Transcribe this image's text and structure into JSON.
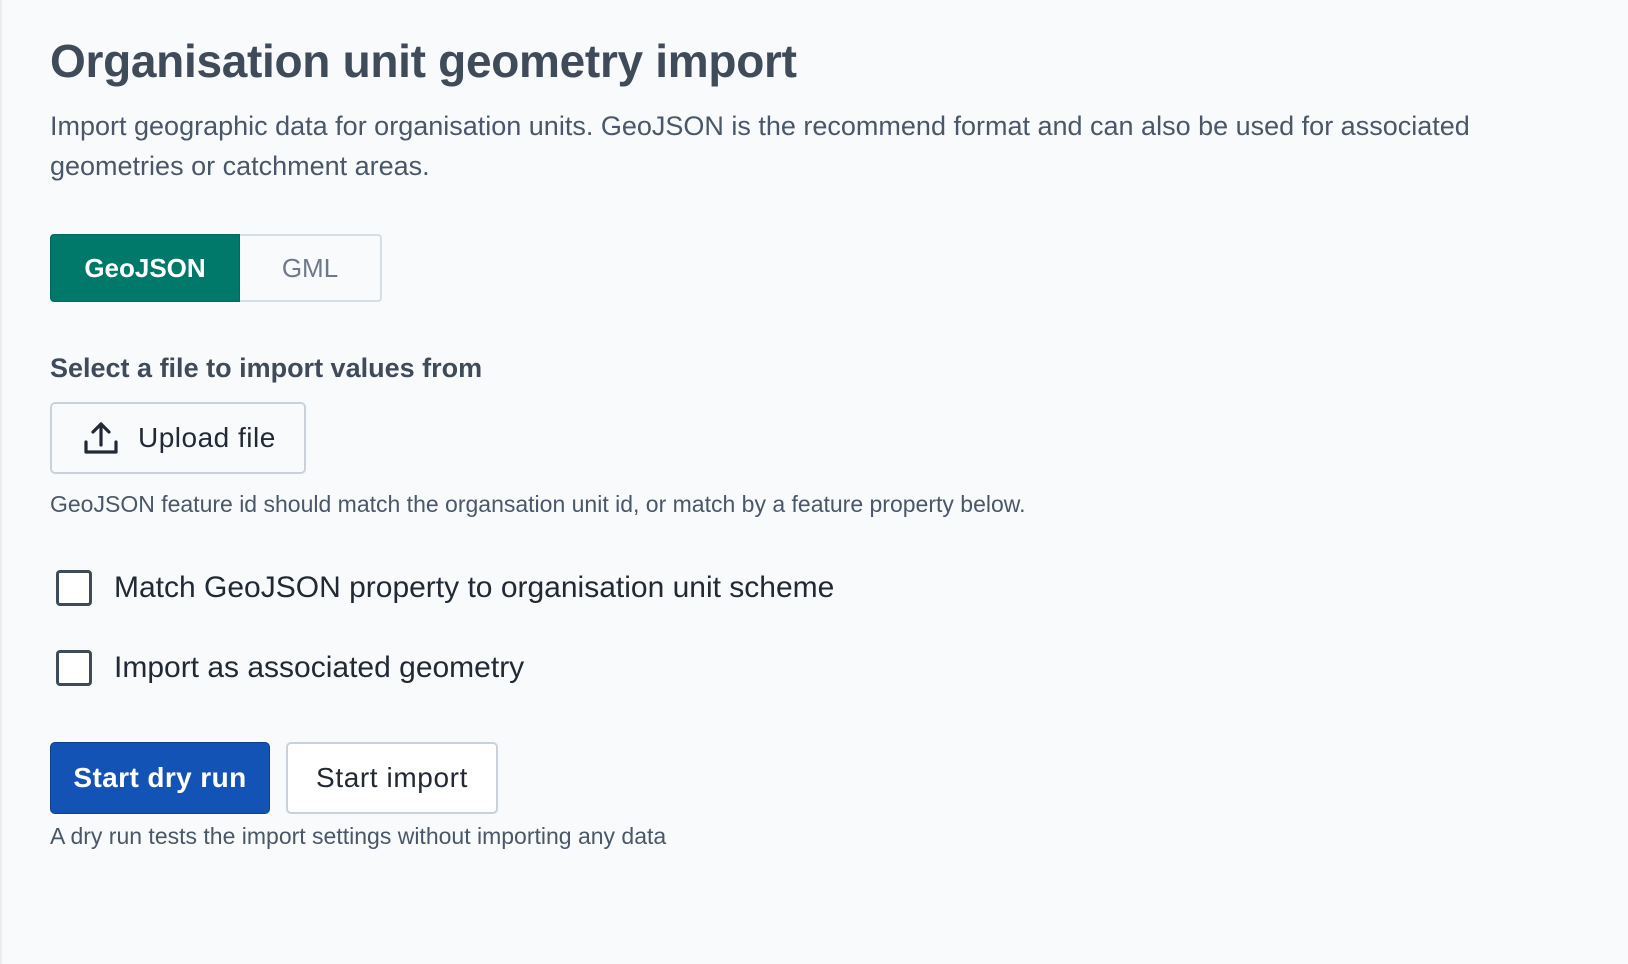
{
  "page": {
    "title": "Organisation unit geometry import",
    "description": "Import geographic data for organisation units. GeoJSON is the recommend format and can also be used for associated geometries or catchment areas."
  },
  "format_toggle": {
    "options": [
      {
        "label": "GeoJSON",
        "selected": true
      },
      {
        "label": "GML",
        "selected": false
      }
    ]
  },
  "file_section": {
    "label": "Select a file to import values from",
    "upload_button": {
      "label": "Upload file",
      "icon": "upload-icon"
    },
    "help": "GeoJSON feature id should match the organsation unit id, or match by a feature property below."
  },
  "options": {
    "match_property": {
      "label": "Match GeoJSON property to organisation unit scheme",
      "checked": false
    },
    "associated_geometry": {
      "label": "Import as associated geometry",
      "checked": false
    }
  },
  "actions": {
    "dry_run_label": "Start dry run",
    "import_label": "Start import",
    "help": "A dry run tests the import settings without importing any data"
  },
  "colors": {
    "accent_green": "#00796b",
    "primary_blue": "#1353b5",
    "background": "#f8fafc"
  }
}
